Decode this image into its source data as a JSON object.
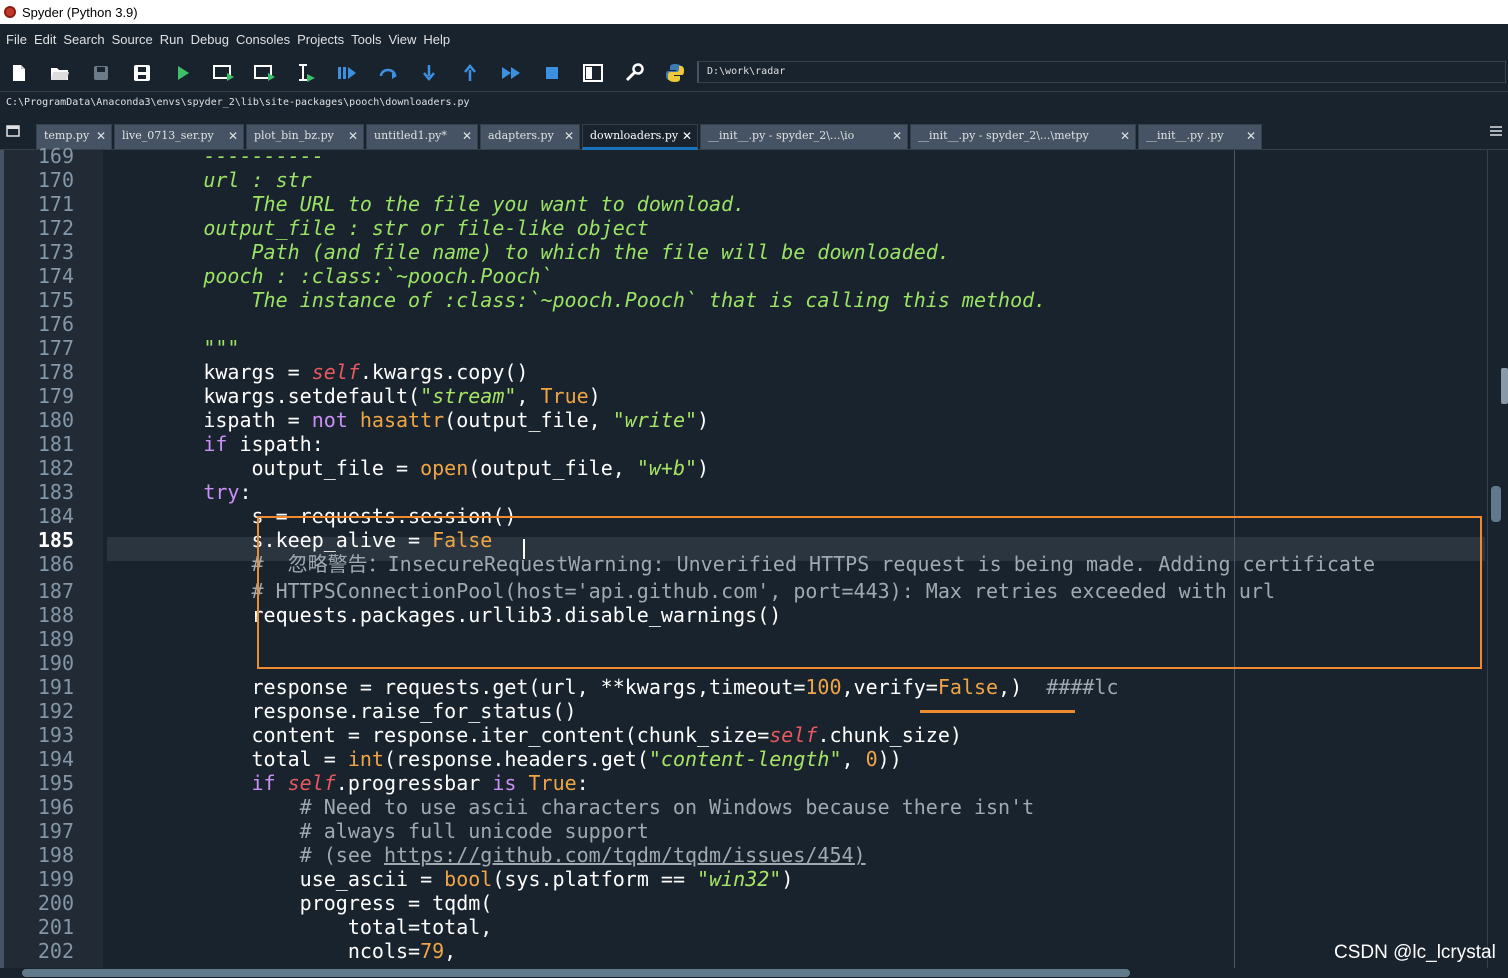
{
  "window": {
    "title": "Spyder (Python 3.9)"
  },
  "menu": [
    "File",
    "Edit",
    "Search",
    "Source",
    "Run",
    "Debug",
    "Consoles",
    "Projects",
    "Tools",
    "View",
    "Help"
  ],
  "toolbar": {
    "working_directory": "D:\\work\\radar",
    "icons": [
      "new-file-icon",
      "open-file-icon",
      "save-icon",
      "save-all-icon",
      "run-icon",
      "run-cell-icon",
      "run-cell-advance-icon",
      "run-selection-icon",
      "debug-icon",
      "step-icon",
      "step-into-icon",
      "step-return-icon",
      "continue-icon",
      "stop-icon",
      "maximize-pane-icon",
      "preferences-icon",
      "python-path-icon"
    ]
  },
  "file_path": "C:\\ProgramData\\Anaconda3\\envs\\spyder_2\\lib\\site-packages\\pooch\\downloaders.py",
  "tabs": [
    {
      "label": "temp.py",
      "active": false
    },
    {
      "label": "live_0713_ser.py",
      "active": false
    },
    {
      "label": "plot_bin_bz.py",
      "active": false
    },
    {
      "label": "untitled1.py*",
      "active": false
    },
    {
      "label": "adapters.py",
      "active": false
    },
    {
      "label": "downloaders.py",
      "active": true
    },
    {
      "label": "__init__.py - spyder_2\\...\\io",
      "active": false
    },
    {
      "label": "__init__.py - spyder_2\\...\\metpy",
      "active": false
    },
    {
      "label": "__init__.py .py",
      "active": false
    }
  ],
  "tab_close_glyph": "✕",
  "editor": {
    "current_line": 185,
    "lines": [
      {
        "n": "169",
        "t": [
          [
            "doc",
            "        ----------"
          ]
        ]
      },
      {
        "n": "170",
        "t": [
          [
            "doc",
            "        url : str"
          ]
        ]
      },
      {
        "n": "171",
        "t": [
          [
            "doc",
            "            The URL to the file you want to download."
          ]
        ]
      },
      {
        "n": "172",
        "t": [
          [
            "doc",
            "        output_file : str or file-like object"
          ]
        ]
      },
      {
        "n": "173",
        "t": [
          [
            "doc",
            "            Path (and file name) to which the file will be downloaded."
          ]
        ]
      },
      {
        "n": "174",
        "t": [
          [
            "doc",
            "        pooch : :class:`~pooch.Pooch`"
          ]
        ]
      },
      {
        "n": "175",
        "t": [
          [
            "doc",
            "            The instance of :class:`~pooch.Pooch` that is calling this method."
          ]
        ]
      },
      {
        "n": "176",
        "t": []
      },
      {
        "n": "177",
        "t": [
          [
            "doc",
            "        \"\"\""
          ]
        ]
      },
      {
        "n": "178",
        "t": [
          [
            "p",
            "        kwargs = "
          ],
          [
            "self",
            "self"
          ],
          [
            "p",
            ".kwargs.copy()"
          ]
        ]
      },
      {
        "n": "179",
        "t": [
          [
            "p",
            "        kwargs.setdefault("
          ],
          [
            "st",
            "\"stream\""
          ],
          [
            "p",
            ", "
          ],
          [
            "bi",
            "True"
          ],
          [
            "p",
            ")"
          ]
        ]
      },
      {
        "n": "180",
        "t": [
          [
            "p",
            "        ispath = "
          ],
          [
            "kw",
            "not"
          ],
          [
            "p",
            " "
          ],
          [
            "bi",
            "hasattr"
          ],
          [
            "p",
            "(output_file, "
          ],
          [
            "st",
            "\"write\""
          ],
          [
            "p",
            ")"
          ]
        ]
      },
      {
        "n": "181",
        "t": [
          [
            "kw",
            "        if"
          ],
          [
            "p",
            " ispath:"
          ]
        ]
      },
      {
        "n": "182",
        "t": [
          [
            "p",
            "            output_file = "
          ],
          [
            "bi",
            "open"
          ],
          [
            "p",
            "(output_file, "
          ],
          [
            "st",
            "\"w+b\""
          ],
          [
            "p",
            ")"
          ]
        ]
      },
      {
        "n": "183",
        "t": [
          [
            "kw",
            "        try"
          ],
          [
            "p",
            ":"
          ]
        ]
      },
      {
        "n": "184",
        "t": [
          [
            "p",
            "            s = requests.session()"
          ]
        ]
      },
      {
        "n": "185",
        "t": [
          [
            "p",
            "            s.keep_alive = "
          ],
          [
            "bi",
            "False"
          ]
        ]
      },
      {
        "n": "186",
        "t": [
          [
            "cm",
            "            #  忽略警告：InsecureRequestWarning: Unverified HTTPS request is being made. Adding certificate"
          ]
        ]
      },
      {
        "n": "187",
        "t": [
          [
            "cm",
            "            # HTTPSConnectionPool(host='api.github.com', port=443): Max retries exceeded with url"
          ]
        ]
      },
      {
        "n": "188",
        "t": [
          [
            "p",
            "            requests.packages.urllib3.disable_warnings()"
          ]
        ]
      },
      {
        "n": "189",
        "t": []
      },
      {
        "n": "190",
        "t": []
      },
      {
        "n": "191",
        "t": [
          [
            "p",
            "            response = requests.get(url, **kwargs,timeout="
          ],
          [
            "num",
            "100"
          ],
          [
            "p",
            ",verify="
          ],
          [
            "bi",
            "False"
          ],
          [
            "p",
            ",)  "
          ],
          [
            "cm",
            "####lc"
          ]
        ]
      },
      {
        "n": "192",
        "t": [
          [
            "p",
            "            response.raise_for_status()"
          ]
        ]
      },
      {
        "n": "193",
        "t": [
          [
            "p",
            "            content = response.iter_content(chunk_size="
          ],
          [
            "self",
            "self"
          ],
          [
            "p",
            ".chunk_size)"
          ]
        ]
      },
      {
        "n": "194",
        "t": [
          [
            "p",
            "            total = "
          ],
          [
            "bi",
            "int"
          ],
          [
            "p",
            "(response.headers.get("
          ],
          [
            "st",
            "\"content-length\""
          ],
          [
            "p",
            ", "
          ],
          [
            "num",
            "0"
          ],
          [
            "p",
            "))"
          ]
        ]
      },
      {
        "n": "195",
        "t": [
          [
            "kw",
            "            if"
          ],
          [
            "p",
            " "
          ],
          [
            "self",
            "self"
          ],
          [
            "p",
            ".progressbar "
          ],
          [
            "kw",
            "is"
          ],
          [
            "p",
            " "
          ],
          [
            "bi",
            "True"
          ],
          [
            "p",
            ":"
          ]
        ]
      },
      {
        "n": "196",
        "t": [
          [
            "cm",
            "                # Need to use ascii characters on Windows because there isn't"
          ]
        ]
      },
      {
        "n": "197",
        "t": [
          [
            "cm",
            "                # always full unicode support"
          ]
        ]
      },
      {
        "n": "198",
        "t": [
          [
            "cm",
            "                # (see "
          ],
          [
            "link",
            "https://github.com/tqdm/tqdm/issues/454)"
          ]
        ]
      },
      {
        "n": "199",
        "t": [
          [
            "p",
            "                use_ascii = "
          ],
          [
            "bi",
            "bool"
          ],
          [
            "p",
            "(sys.platform == "
          ],
          [
            "st",
            "\"win32\""
          ],
          [
            "p",
            ")"
          ]
        ]
      },
      {
        "n": "200",
        "t": [
          [
            "p",
            "                progress = tqdm("
          ]
        ]
      },
      {
        "n": "201",
        "t": [
          [
            "p",
            "                    total=total,"
          ]
        ]
      },
      {
        "n": "202",
        "t": [
          [
            "p",
            "                    ncols="
          ],
          [
            "num",
            "79"
          ],
          [
            "p",
            ","
          ]
        ]
      }
    ]
  },
  "watermark": "CSDN @lc_lcrystal",
  "colors": {
    "background": "#19232D",
    "docstring": "#9BE365",
    "keyword": "#C990F5",
    "builtin": "#F0A545",
    "self": "#E7585F",
    "comment": "#A0A8B0",
    "annotation": "#F08A2E",
    "active_tab_accent": "#1A72BB"
  }
}
